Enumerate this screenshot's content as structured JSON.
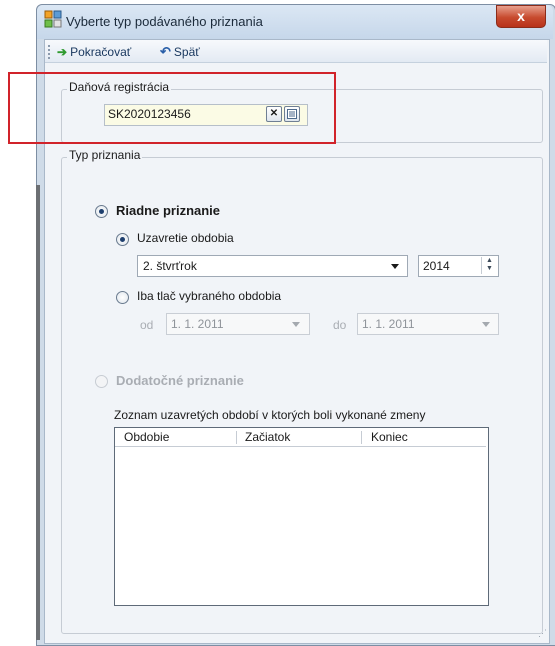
{
  "window": {
    "title": "Vyberte typ podávaného priznania",
    "close_label": "x"
  },
  "toolbar": {
    "continue_label": "Pokračovať",
    "back_label": "Späť"
  },
  "registration": {
    "group_label": "Daňová registrácia",
    "value": "SK2020123456"
  },
  "type": {
    "group_label": "Typ priznania",
    "regular_label": "Riadne priznanie",
    "closing_label": "Uzavretie obdobia",
    "quarter_value": "2. štvrťrok",
    "year_value": "2014",
    "print_only_label": "Iba tlač vybraného obdobia",
    "from_label": "od",
    "from_value": "1. 1. 2011",
    "to_label": "do",
    "to_value": "1. 1. 2011",
    "supplementary_label": "Dodatočné priznanie",
    "list_caption": "Zoznam uzavretých období v ktorých boli vykonané zmeny",
    "columns": [
      "Obdobie",
      "Začiatok",
      "Koniec"
    ]
  },
  "colors": {
    "highlight_border": "#d1232a",
    "input_bg": "#fbfbe5",
    "accent": "#17365d"
  }
}
